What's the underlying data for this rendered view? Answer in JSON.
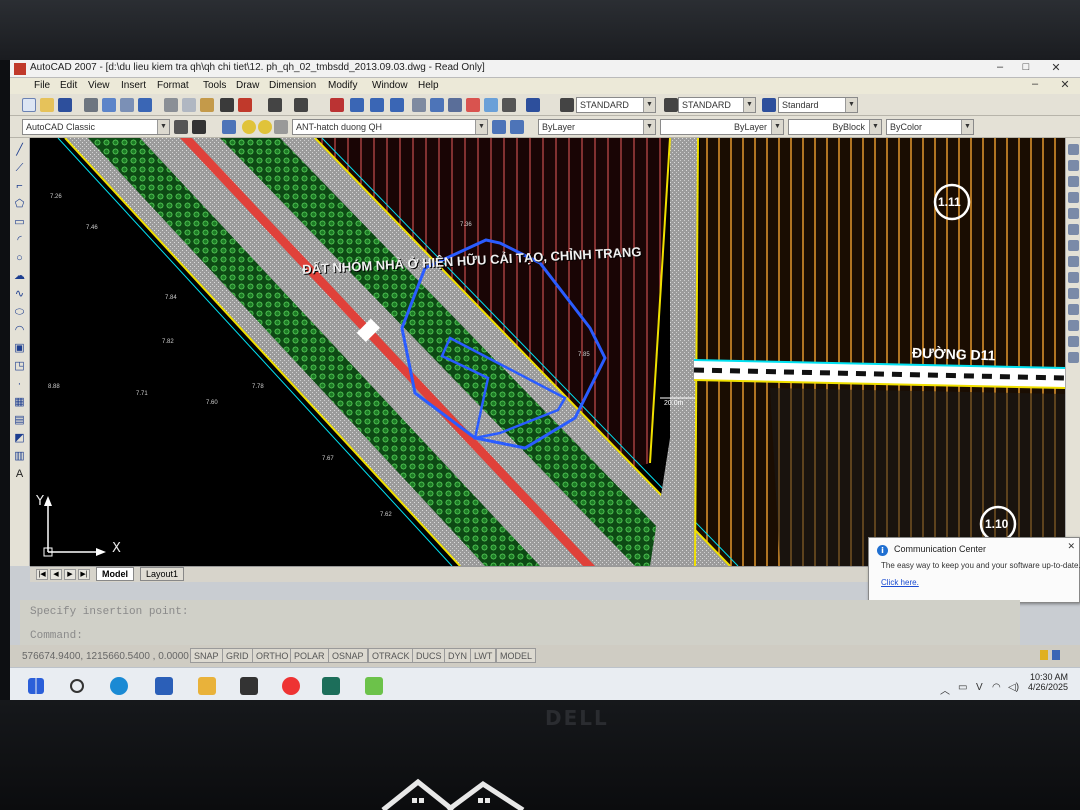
{
  "window": {
    "title": "AutoCAD 2007 - [d:\\du lieu kiem tra qh\\qh chi tiet\\12. ph_qh_02_tmbsdd_2013.09.03.dwg - Read Only]"
  },
  "menu": [
    "File",
    "Edit",
    "View",
    "Insert",
    "Format",
    "Tools",
    "Draw",
    "Dimension",
    "Modify",
    "Window",
    "Help"
  ],
  "toolbar": {
    "text_style": "STANDARD",
    "dim_style": "STANDARD",
    "table_style": "Standard",
    "workspace": "AutoCAD Classic",
    "layer": "ANT-hatch duong QH",
    "color": "ByLayer",
    "linetype": "ByLayer",
    "lineweight": "ByBlock",
    "plotstyle": "ByColor"
  },
  "drawing": {
    "zone_label": "ĐẤT NHÓM NHÀ Ở HIỆN HỮU CẢI TẠO, CHỈNH TRANG",
    "road_label": "ĐƯỜNG D11",
    "zone_tag_1": "1.11",
    "zone_tag_2": "1.10",
    "width_label": "20.0m",
    "elevations": [
      "7.26",
      "7.46",
      "7.84",
      "7.82",
      "7.71",
      "7.78",
      "7.60",
      "7.67",
      "7.62",
      "7.85",
      "7.36",
      "8.88"
    ]
  },
  "ucs": {
    "x": "X",
    "y": "Y"
  },
  "tabs": [
    "Model",
    "Layout1"
  ],
  "command": {
    "history": "Specify insertion point:",
    "prompt": "Command:"
  },
  "status": {
    "coords": "576674.9400, 1215660.5400 , 0.0000",
    "buttons": [
      "SNAP",
      "GRID",
      "ORTHO",
      "POLAR",
      "OSNAP",
      "OTRACK",
      "DUCS",
      "DYN",
      "LWT",
      "MODEL"
    ]
  },
  "notification": {
    "title": "Communication Center",
    "message": "The easy way to keep you and your software up-to-date.",
    "link": "Click here."
  },
  "clock": {
    "time": "10:30 AM",
    "date": "4/26/2025"
  },
  "brand": "DELL"
}
